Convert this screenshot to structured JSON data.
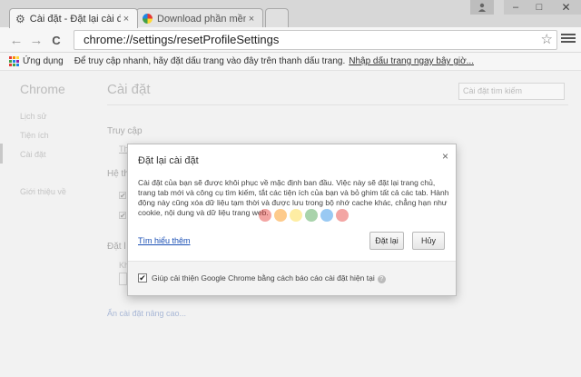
{
  "tabs": [
    {
      "label": "Cài đặt - Đặt lại cài đặt",
      "close": "×"
    },
    {
      "label": "Download phần mềm miễ",
      "close": "×"
    }
  ],
  "window_controls": {
    "min": "–",
    "max": "□",
    "close": "✕"
  },
  "toolbar": {
    "back": "←",
    "forward": "→",
    "reload": "C",
    "url": "chrome://settings/resetProfileSettings",
    "star": "☆"
  },
  "bookmarks_bar": {
    "apps_label": "Ứng dụng",
    "hint": "Để truy cập nhanh, hãy đặt dấu trang vào đây trên thanh dấu trang.",
    "import_link": "Nhập dấu trang ngay bây giờ..."
  },
  "sidebar": {
    "title": "Chrome",
    "items": [
      {
        "label": "Lịch sử"
      },
      {
        "label": "Tiện ích"
      },
      {
        "label": "Cài đặt"
      },
      {
        "label": "Giới thiệu về"
      }
    ]
  },
  "main": {
    "title": "Cài đặt",
    "search_placeholder": "Cài đặt tìm kiếm",
    "heading_access": "Truy cập",
    "text_access_fragment": "Th",
    "heading_system": "Hệ th",
    "heading_reset": "Đặt l",
    "text_reset_fragment": "Khô",
    "advanced_link": "Ẩn cài đặt nâng cao..."
  },
  "dialog": {
    "title": "Đặt lại cài đặt",
    "close": "×",
    "body": "Cài đặt của bạn sẽ được khôi phục về mặc định ban đầu. Việc này sẽ đặt lại trang chủ, trang tab mới và công cụ tìm kiếm, tắt các tiện ích của bạn và bỏ ghim tất cả các tab. Hành động này cũng xóa dữ liệu tạm thời và được lưu trong bộ nhớ cache khác, chẳng hạn như cookie, nội dung và dữ liệu trang web.",
    "learn_more": "Tìm hiểu thêm",
    "reset_button": "Đặt lại",
    "cancel_button": "Hủy",
    "report_checkbox_checked": true,
    "report_label": "Giúp cải thiện Google Chrome bằng cách báo cáo cài đặt hiện tại",
    "help_icon": "?"
  },
  "colors": {
    "watermark": [
      "#e53935",
      "#fb8c00",
      "#fdd835",
      "#43a047",
      "#1e88e5",
      "#e53935"
    ],
    "apps_icon": [
      "#e53935",
      "#fb8c00",
      "#fdd835",
      "#43a047",
      "#1e88e5",
      "#8e24aa",
      "#e53935",
      "#43a047",
      "#1e88e5"
    ]
  }
}
